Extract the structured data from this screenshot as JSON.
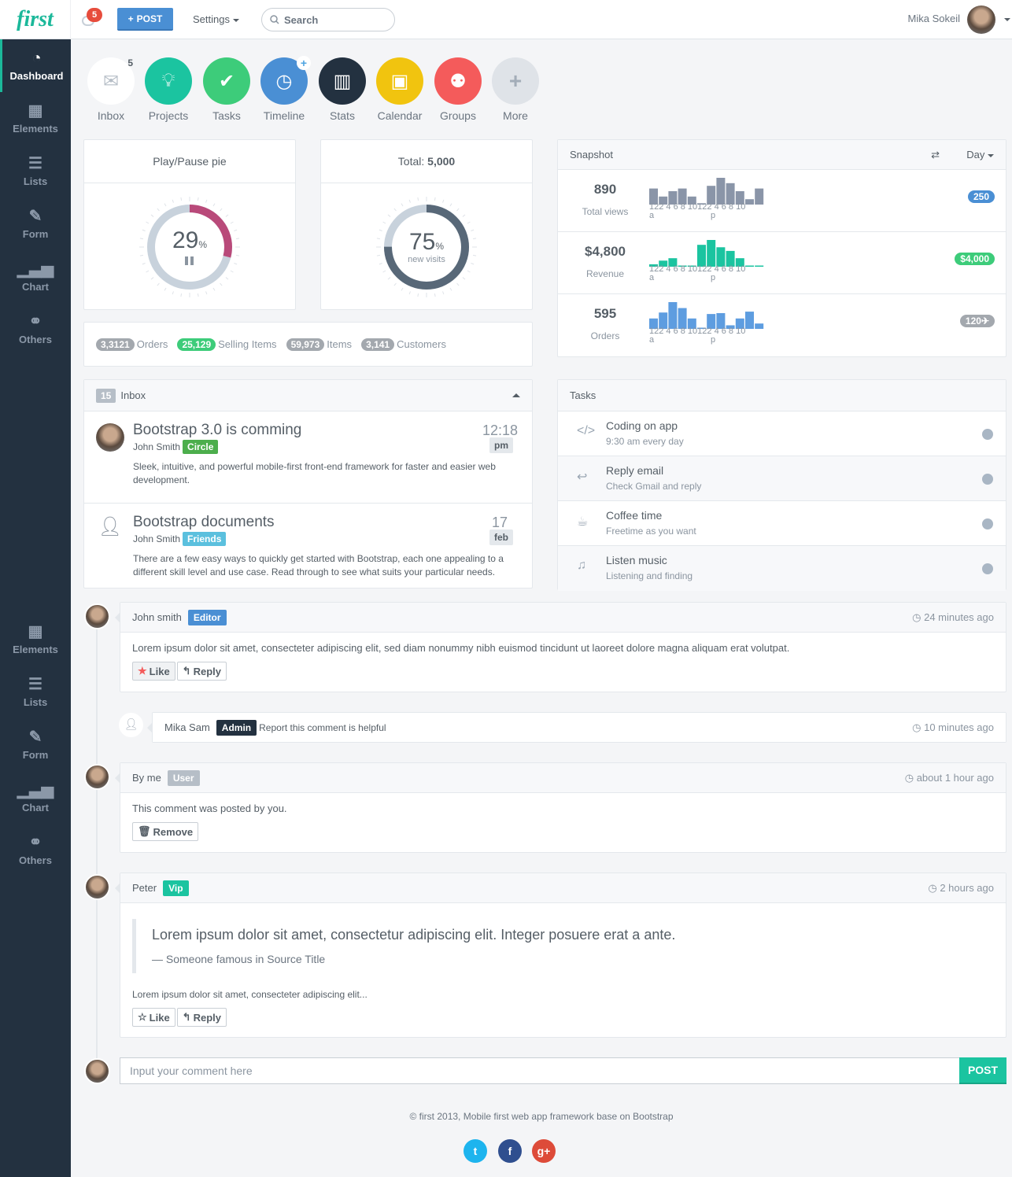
{
  "header": {
    "logo": "first",
    "notification_count": "5",
    "post_label": "POST",
    "settings_label": "Settings",
    "search_placeholder": "Search",
    "user_name": "Mika Sokeil"
  },
  "sidebar": {
    "items": [
      {
        "label": "Dashboard",
        "icon": "dashboard-icon",
        "active": true
      },
      {
        "label": "Elements",
        "icon": "grid-icon"
      },
      {
        "label": "Lists",
        "icon": "list-icon"
      },
      {
        "label": "Form",
        "icon": "edit-icon"
      },
      {
        "label": "Chart",
        "icon": "signal-icon"
      },
      {
        "label": "Others",
        "icon": "link-icon"
      }
    ],
    "items_repeat": [
      {
        "label": "Elements",
        "icon": "grid-icon"
      },
      {
        "label": "Lists",
        "icon": "list-icon"
      },
      {
        "label": "Form",
        "icon": "edit-icon"
      },
      {
        "label": "Chart",
        "icon": "signal-icon"
      },
      {
        "label": "Others",
        "icon": "link-icon"
      }
    ]
  },
  "shortcuts": [
    {
      "label": "Inbox",
      "icon": "envelope-icon",
      "color": "#ffffff",
      "badge": "5"
    },
    {
      "label": "Projects",
      "icon": "lightbulb-icon",
      "color": "#1bc4a0"
    },
    {
      "label": "Tasks",
      "icon": "check-icon",
      "color": "#3dcc7a"
    },
    {
      "label": "Timeline",
      "icon": "clock-icon",
      "color": "#4a8fd4",
      "plus": "+"
    },
    {
      "label": "Stats",
      "icon": "bar-chart-icon",
      "color": "#233140"
    },
    {
      "label": "Calendar",
      "icon": "calendar-icon",
      "color": "#f1c40f"
    },
    {
      "label": "Groups",
      "icon": "users-icon",
      "color": "#f45b5b"
    },
    {
      "label": "More",
      "icon": "plus-icon",
      "color": "#dfe3e8"
    }
  ],
  "pie1": {
    "title": "Play/Pause pie",
    "value": "29",
    "unit": "%",
    "percent": 29,
    "color": "#b94a7a"
  },
  "pie2": {
    "title_prefix": "Total: ",
    "title_value": "5,000",
    "value": "75",
    "unit": "%",
    "sub": "new visits",
    "percent": 75,
    "color": "#586878"
  },
  "stats": [
    {
      "value": "3,3121",
      "label": "Orders",
      "color": "gray"
    },
    {
      "value": "25,129",
      "label": "Selling Items",
      "color": "green"
    },
    {
      "value": "59,973",
      "label": "Items",
      "color": "gray"
    },
    {
      "value": "3,141",
      "label": "Customers",
      "color": "gray"
    }
  ],
  "snapshot": {
    "title": "Snapshot",
    "period": "Day",
    "axis_labels": "122 4 6 8 10122 4 6 8 10",
    "axis_sub": [
      "a",
      "p"
    ],
    "rows": [
      {
        "value": "890",
        "label": "Total views",
        "badge": "250",
        "badge_color": "#4a8fd4",
        "bar_color": "#8a95a8",
        "bars": [
          6,
          3,
          5,
          6,
          3,
          0.5,
          7,
          10,
          8,
          5,
          2,
          6
        ]
      },
      {
        "value": "$4,800",
        "label": "Revenue",
        "badge": "$4,000",
        "badge_color": "#3dcc7a",
        "bar_color": "#1bc4a0",
        "bars": [
          1,
          2.5,
          3.5,
          0.3,
          0.3,
          9,
          11,
          8,
          6.5,
          3.5,
          0.3,
          0.3
        ]
      },
      {
        "value": "595",
        "label": "Orders",
        "badge": "120✈",
        "badge_color": "#a3a8ae",
        "bar_color": "#5e9de0",
        "bars": [
          3.5,
          5.5,
          9,
          7,
          3.5,
          0.4,
          5,
          5.3,
          1.2,
          3.5,
          5.8,
          1.8
        ]
      }
    ]
  },
  "inbox": {
    "count": "15",
    "title": "Inbox",
    "messages": [
      {
        "subject": "Bootstrap 3.0 is comming",
        "from": "John Smith",
        "tag": "Circle",
        "tag_color": "#4cae4c",
        "body": "Sleek, intuitive, and powerful mobile-first front-end framework for faster and easier web development.",
        "time": "12:18",
        "time_sub": "pm"
      },
      {
        "subject": "Bootstrap documents",
        "from": "John Smith",
        "tag": "Friends",
        "tag_color": "#5bc0de",
        "body": "There are a few easy ways to quickly get started with Bootstrap, each one appealing to a different skill level and use case. Read through to see what suits your particular needs.",
        "time": "17",
        "time_sub": "feb"
      }
    ]
  },
  "tasks": {
    "title": "Tasks",
    "items": [
      {
        "title": "Coding on app",
        "sub": "9:30 am every day",
        "icon": "code-icon"
      },
      {
        "title": "Reply email",
        "sub": "Check Gmail and reply",
        "icon": "reply-icon"
      },
      {
        "title": "Coffee time",
        "sub": "Freetime as you want",
        "icon": "coffee-icon"
      },
      {
        "title": "Listen music",
        "sub": "Listening and finding",
        "icon": "music-icon"
      }
    ]
  },
  "comments": [
    {
      "author": "John smith",
      "role": "Editor",
      "role_color": "#4a8fd4",
      "time": "24 minutes ago",
      "body": "Lorem ipsum dolor sit amet, consecteter adipiscing elit, sed diam nonummy nibh euismod tincidunt ut laoreet dolore magna aliquam erat volutpat.",
      "like": "Like",
      "reply": "Reply"
    },
    {
      "author": "Mika Sam",
      "role": "Admin",
      "role_color": "#233140",
      "time": "10 minutes ago",
      "body": "Report this comment is helpful"
    },
    {
      "author": "By me",
      "role": "User",
      "role_color": "#b6bec7",
      "time": "about 1 hour ago",
      "body": "This comment was posted by you.",
      "remove": "Remove"
    },
    {
      "author": "Peter",
      "role": "Vip",
      "role_color": "#1bc4a0",
      "time": "2 hours ago",
      "quote": "Lorem ipsum dolor sit amet, consectetur adipiscing elit. Integer posuere erat a ante.",
      "quote_source": "— Someone famous in Source Title",
      "body": "Lorem ipsum dolor sit amet, consecteter adipiscing elit...",
      "like": "Like",
      "reply": "Reply"
    }
  ],
  "composer": {
    "placeholder": "Input your comment here",
    "post_label": "POST"
  },
  "footer": {
    "text": "© first 2013, Mobile first web app framework base on Bootstrap"
  },
  "social": [
    {
      "name": "twitter",
      "glyph": "t",
      "color": "#1db4ee"
    },
    {
      "name": "facebook",
      "glyph": "f",
      "color": "#2f4f8f"
    },
    {
      "name": "google-plus",
      "glyph": "g+",
      "color": "#dd4b39"
    }
  ]
}
